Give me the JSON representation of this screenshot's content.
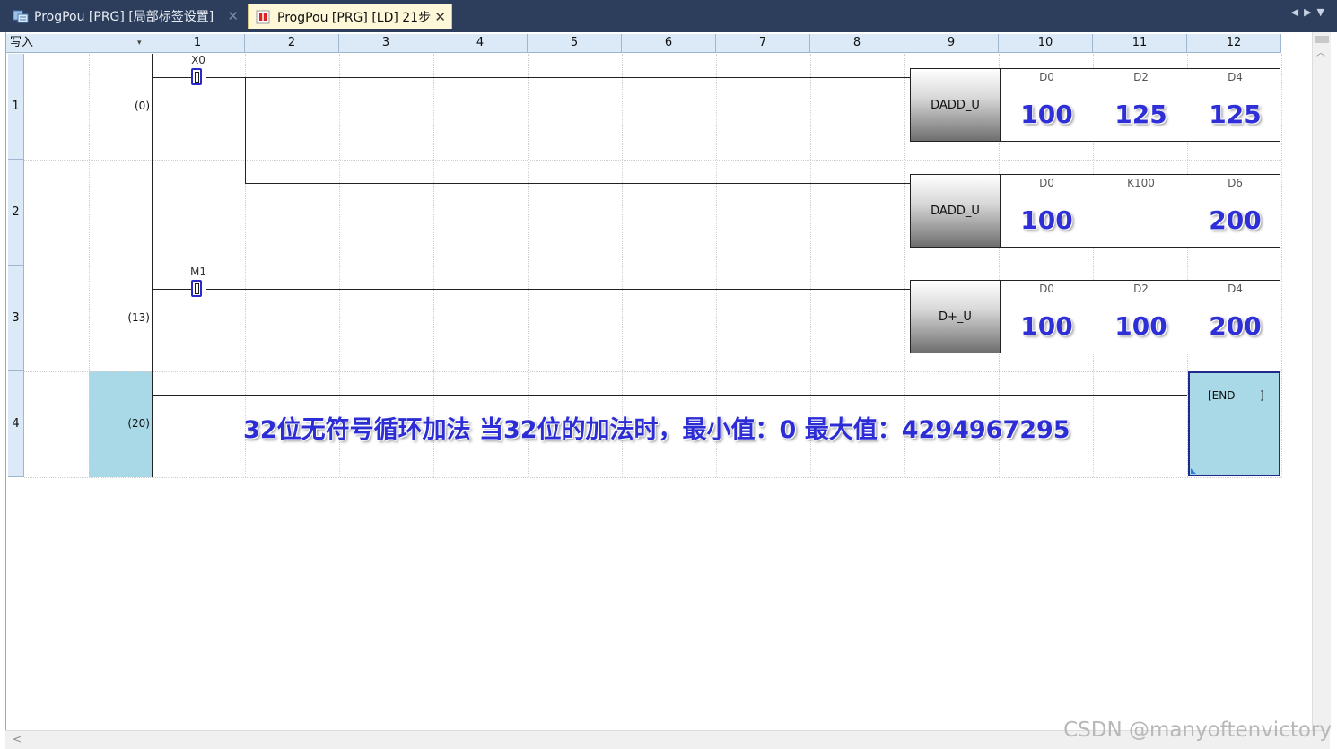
{
  "tabs": [
    {
      "label": "ProgPou [PRG] [局部标签设置]",
      "icon": "label-table-icon",
      "close": "✕"
    },
    {
      "label": "ProgPou [PRG] [LD] 21步",
      "icon": "ladder-icon",
      "close": "✕"
    }
  ],
  "tab_nav": {
    "prev": "◀",
    "next": "▶",
    "menu": "▼"
  },
  "header": {
    "mode": "写入",
    "mode_arrow": "▾",
    "columns": [
      "1",
      "2",
      "3",
      "4",
      "5",
      "6",
      "7",
      "8",
      "9",
      "10",
      "11",
      "12"
    ]
  },
  "rows": [
    {
      "num": "1",
      "step": "(0)"
    },
    {
      "num": "2",
      "step": ""
    },
    {
      "num": "3",
      "step": "(13)"
    },
    {
      "num": "4",
      "step": "(20)"
    }
  ],
  "contacts": {
    "x0": "X0",
    "m1": "M1"
  },
  "instructions": [
    {
      "op": "DADD_U",
      "operands": [
        {
          "name": "D0",
          "value": "100"
        },
        {
          "name": "D2",
          "value": "125"
        },
        {
          "name": "D4",
          "value": "125"
        }
      ]
    },
    {
      "op": "DADD_U",
      "operands": [
        {
          "name": "D0",
          "value": "100"
        },
        {
          "name": "K100",
          "value": ""
        },
        {
          "name": "D6",
          "value": "200"
        }
      ]
    },
    {
      "op": "D+_U",
      "operands": [
        {
          "name": "D0",
          "value": "100"
        },
        {
          "name": "D2",
          "value": "100"
        },
        {
          "name": "D4",
          "value": "200"
        }
      ]
    }
  ],
  "end": {
    "left": "[END",
    "right": "]"
  },
  "annotation": "32位无符号循环加法  当32位的加法时，最小值：0   最大值：4294967295",
  "watermark": "CSDN @manyoftenvictory",
  "colors": {
    "tabbar": "#2c3e5c",
    "header": "#dce9f7",
    "selection": "#a9d8e6",
    "annotation": "#2d2dd6"
  }
}
